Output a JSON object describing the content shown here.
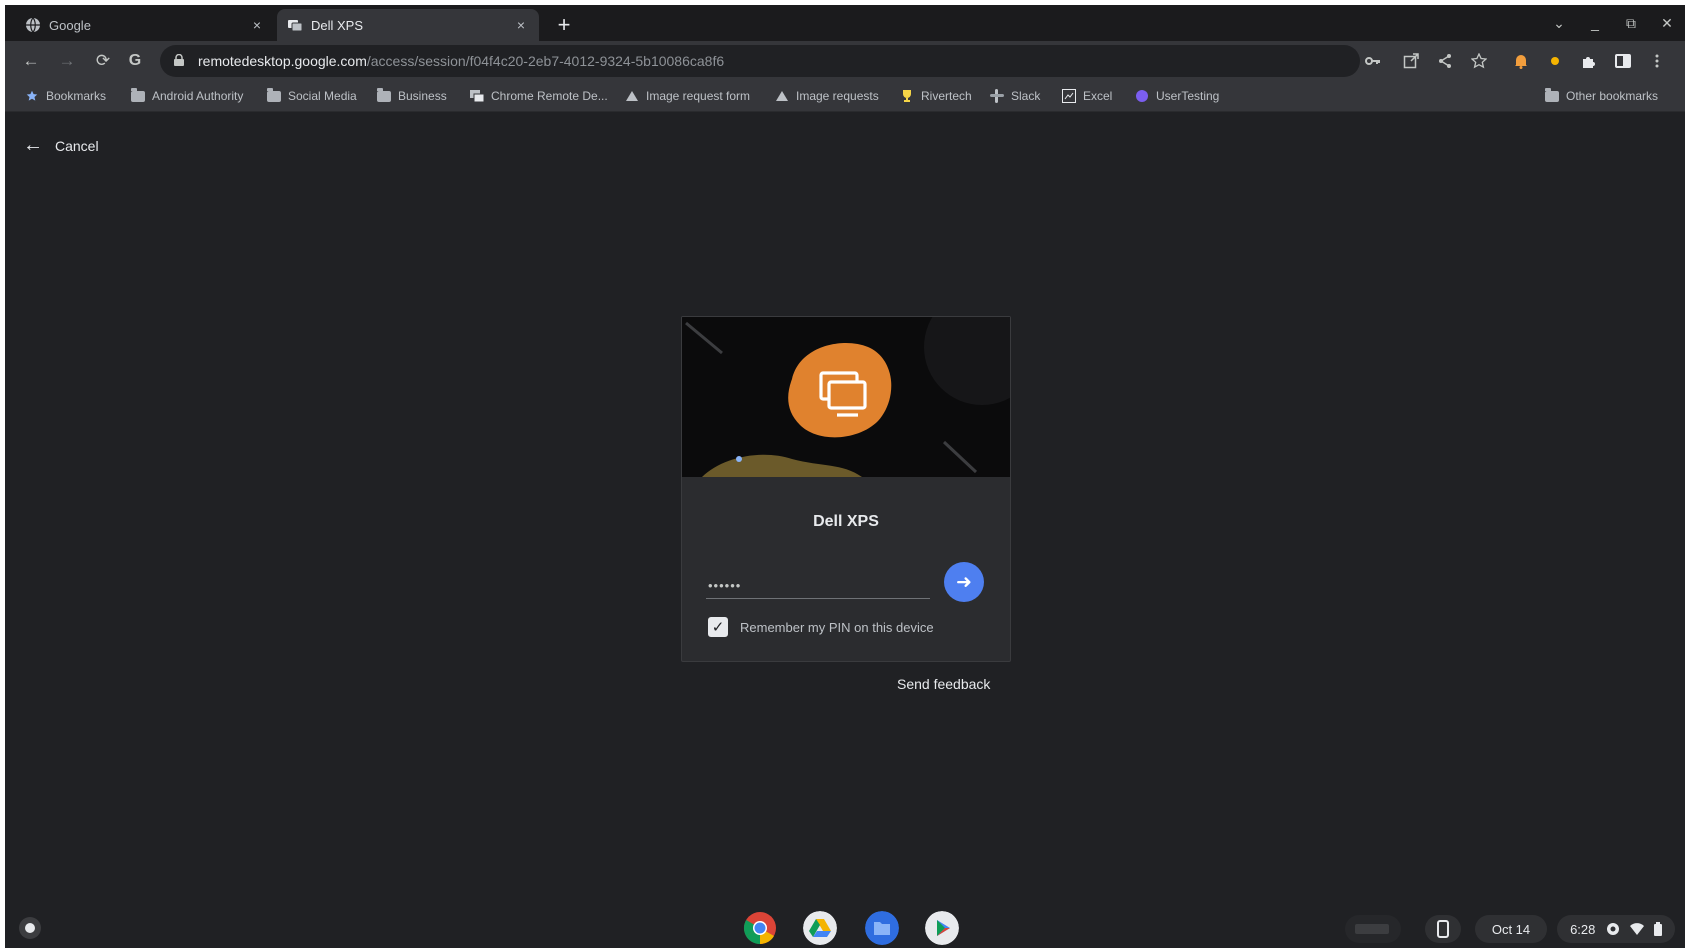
{
  "tabs": [
    {
      "title": "Google",
      "close": "×",
      "favicon": "google-globe-icon"
    },
    {
      "title": "Dell XPS",
      "close": "×",
      "favicon": "remote-desktop-icon"
    }
  ],
  "new_tab_symbol": "+",
  "window_controls": {
    "search_tabs": "⌄",
    "minimize": "_",
    "restore": "⧉",
    "close": "✕"
  },
  "toolbar": {
    "back": "←",
    "forward": "→",
    "reload": "⟳",
    "account_initial": "G",
    "url_host": "remotedesktop.google.com",
    "url_path": "/access/session/f04f4c20-2eb7-4012-9324-5b10086ca8f6"
  },
  "bookmarks": [
    {
      "label": "Bookmarks",
      "icon": "star-icon"
    },
    {
      "label": "Android Authority",
      "icon": "folder-icon"
    },
    {
      "label": "Social Media",
      "icon": "folder-icon"
    },
    {
      "label": "Business",
      "icon": "folder-icon"
    },
    {
      "label": "Chrome Remote De...",
      "icon": "remote-desktop-icon"
    },
    {
      "label": "Image request form",
      "icon": "form-icon"
    },
    {
      "label": "Image requests",
      "icon": "form-icon"
    },
    {
      "label": "Rivertech",
      "icon": "trophy-icon"
    },
    {
      "label": "Slack",
      "icon": "slack-icon"
    },
    {
      "label": "Excel",
      "icon": "sheet-icon"
    },
    {
      "label": "UserTesting",
      "icon": "usertesting-icon"
    }
  ],
  "other_bookmarks": "Other bookmarks",
  "page": {
    "cancel_label": "Cancel",
    "host_name": "Dell XPS",
    "pin_value": "••••••",
    "remember_label": "Remember my PIN on this device",
    "remember_checked": true,
    "send_feedback": "Send feedback",
    "accent_color": "#4e7ff0",
    "logo_color": "#e0822e"
  },
  "shelf": {
    "apps": [
      "chrome-icon",
      "drive-icon",
      "files-icon",
      "play-store-icon"
    ],
    "date": "Oct 14",
    "time": "6:28"
  }
}
